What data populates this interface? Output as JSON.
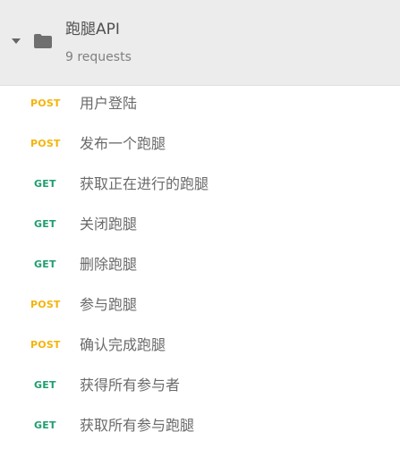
{
  "collection": {
    "name": "跑腿API",
    "count": "9 requests",
    "colors": {
      "header_bg": "#ececec",
      "post": "#f5b40a",
      "get": "#1f9e6f"
    },
    "icons": [
      "caret-down-icon",
      "folder-icon"
    ]
  },
  "requests": [
    {
      "method": "POST",
      "name": "用户登陆"
    },
    {
      "method": "POST",
      "name": "发布一个跑腿"
    },
    {
      "method": "GET",
      "name": "获取正在进行的跑腿"
    },
    {
      "method": "GET",
      "name": "关闭跑腿"
    },
    {
      "method": "GET",
      "name": "删除跑腿"
    },
    {
      "method": "POST",
      "name": "参与跑腿"
    },
    {
      "method": "POST",
      "name": "确认完成跑腿"
    },
    {
      "method": "GET",
      "name": "获得所有参与者"
    },
    {
      "method": "GET",
      "name": "获取所有参与跑腿"
    }
  ]
}
